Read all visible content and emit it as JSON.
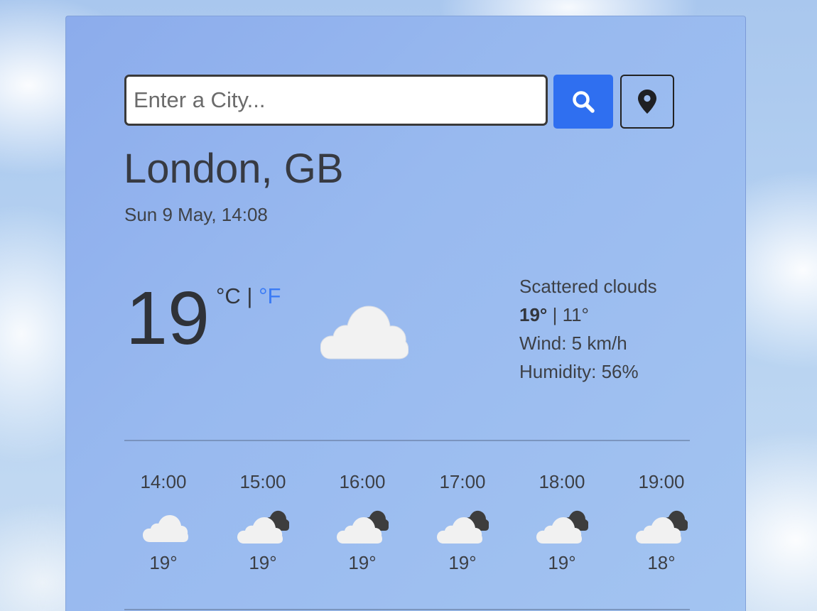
{
  "search": {
    "placeholder": "Enter a City...",
    "value": ""
  },
  "location": {
    "city": "London, GB",
    "datetime": "Sun 9 May, 14:08"
  },
  "current": {
    "temperature": "19",
    "unit_c": "°C",
    "separator": "|",
    "unit_f": "°F",
    "icon": "cloud-icon",
    "description": "Scattered clouds",
    "high": "19°",
    "low_separator": "|",
    "low": "11°",
    "wind": "Wind: 5 km/h",
    "humidity": "Humidity: 56%"
  },
  "hourly": [
    {
      "time": "14:00",
      "icon": "cloud-icon",
      "temp": "19°"
    },
    {
      "time": "15:00",
      "icon": "broken-clouds-icon",
      "temp": "19°"
    },
    {
      "time": "16:00",
      "icon": "broken-clouds-icon",
      "temp": "19°"
    },
    {
      "time": "17:00",
      "icon": "broken-clouds-icon",
      "temp": "19°"
    },
    {
      "time": "18:00",
      "icon": "broken-clouds-icon",
      "temp": "19°"
    },
    {
      "time": "19:00",
      "icon": "broken-clouds-icon",
      "temp": "18°"
    }
  ],
  "colors": {
    "accent": "#2f6ff0",
    "unit_link": "#3b7bf5"
  }
}
